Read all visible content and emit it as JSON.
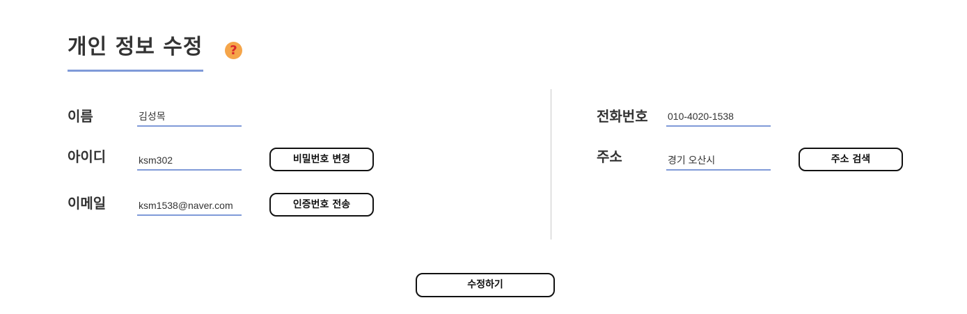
{
  "header": {
    "title": "개인 정보 수정",
    "help_icon": "?"
  },
  "left": {
    "name": {
      "label": "이름",
      "value": "김성목"
    },
    "id": {
      "label": "아이디",
      "value": "ksm302",
      "button": "비밀번호 변경"
    },
    "email": {
      "label": "이메일",
      "value": "ksm1538@naver.com",
      "button": "인증번호 전송"
    }
  },
  "right": {
    "phone": {
      "label": "전화번호",
      "value": "010-4020-1538"
    },
    "address": {
      "label": "주소",
      "value": "경기 오산시",
      "button": "주소 검색"
    }
  },
  "footer": {
    "submit": "수정하기"
  },
  "colors": {
    "underline": "#7f9ad8",
    "help_icon_bg": "#f5a54a",
    "help_icon_fg": "#d9262b",
    "divider": "#c8c8c8"
  }
}
